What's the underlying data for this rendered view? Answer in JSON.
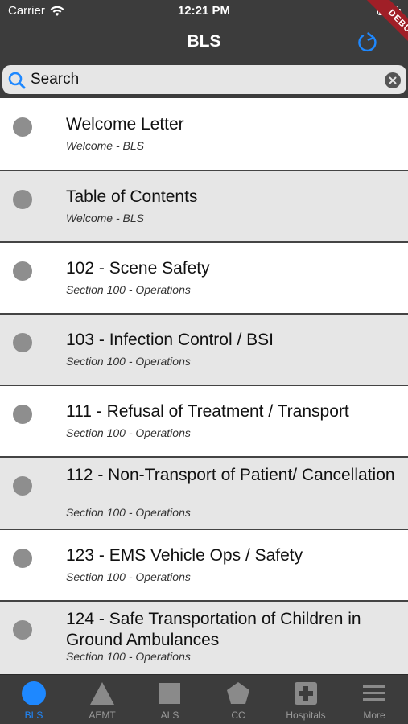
{
  "status_bar": {
    "carrier": "Carrier",
    "time": "12:21 PM"
  },
  "nav": {
    "title": "BLS"
  },
  "debug_banner": "DEBUG",
  "search": {
    "placeholder": "Search",
    "value": ""
  },
  "items": [
    {
      "title": "Welcome Letter",
      "subtitle": "Welcome - BLS"
    },
    {
      "title": "Table of Contents",
      "subtitle": "Welcome - BLS"
    },
    {
      "title": "102 - Scene Safety",
      "subtitle": "Section 100 - Operations"
    },
    {
      "title": "103 - Infection Control / BSI",
      "subtitle": "Section 100 - Operations"
    },
    {
      "title": "111 - Refusal of Treatment / Transport",
      "subtitle": "Section 100 - Operations"
    },
    {
      "title": "112 - Non-Transport of Patient/ Cancellation",
      "subtitle": "Section 100 - Operations"
    },
    {
      "title": "123 - EMS Vehicle Ops / Safety",
      "subtitle": "Section 100 - Operations"
    },
    {
      "title": "124 - Safe Transportation of Children in Ground Ambulances",
      "subtitle": "Section 100 - Operations"
    }
  ],
  "tabs": [
    {
      "label": "BLS",
      "icon": "circle-icon",
      "active": true
    },
    {
      "label": "AEMT",
      "icon": "triangle-icon",
      "active": false
    },
    {
      "label": "ALS",
      "icon": "square-icon",
      "active": false
    },
    {
      "label": "CC",
      "icon": "pentagon-icon",
      "active": false
    },
    {
      "label": "Hospitals",
      "icon": "hospital-cross-icon",
      "active": false
    },
    {
      "label": "More",
      "icon": "menu-icon",
      "active": false
    }
  ],
  "colors": {
    "header_bg": "#3c3c3c",
    "accent": "#1e88ff",
    "row_alt": "#e6e6e6",
    "bullet": "#8e8e8e",
    "debug": "#a01f27"
  }
}
